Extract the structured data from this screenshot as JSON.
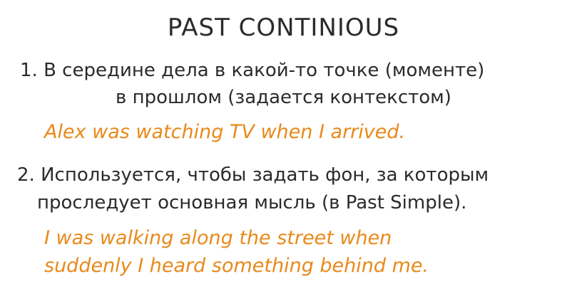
{
  "title": "PAST CONTINIOUS",
  "rule1": {
    "line1": "1. В середине дела в какой-то точке (моменте)",
    "line2": "в прошлом (задается контекстом)",
    "example": "Alex was watching TV when I arrived."
  },
  "rule2": {
    "line1": "2. Используется, чтобы задать фон, за которым",
    "line2": "проследует основная мысль (в Past Simple).",
    "example_line1": "I was walking along the street when",
    "example_line2": "suddenly I heard something behind me."
  },
  "colors": {
    "text": "#2b2b2b",
    "example": "#e8891a",
    "background": "#ffffff"
  }
}
